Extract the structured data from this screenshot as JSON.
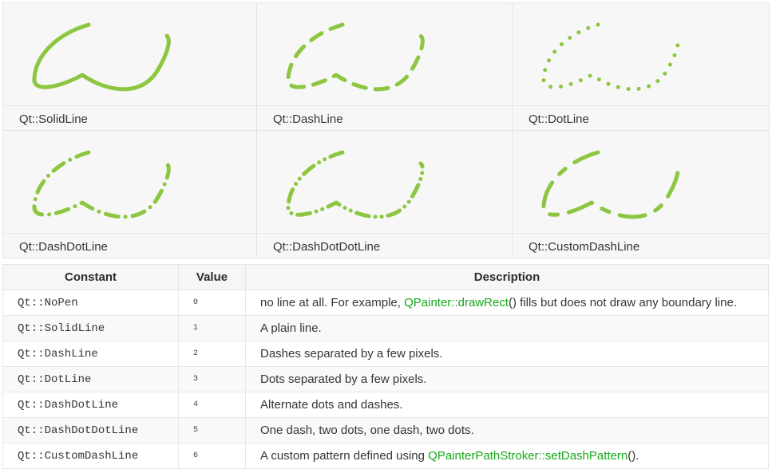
{
  "colors": {
    "stroke": "#8dc640",
    "link": "#17a81a",
    "text": "#363534"
  },
  "pens": [
    {
      "caption": "Qt::SolidLine",
      "dash": ""
    },
    {
      "caption": "Qt::DashLine",
      "dash": "16 12"
    },
    {
      "caption": "Qt::DotLine",
      "dash": "0 13"
    },
    {
      "caption": "Qt::DashDotLine",
      "dash": "16 9 0 9"
    },
    {
      "caption": "Qt::DashDotDotLine",
      "dash": "16 8 0 8 0 8"
    },
    {
      "caption": "Qt::CustomDashLine",
      "dash": "32 14 10 14"
    }
  ],
  "table": {
    "headers": {
      "constant": "Constant",
      "value": "Value",
      "description": "Description"
    },
    "rows": [
      {
        "constant": "Qt::NoPen",
        "value": "0",
        "desc_before": "no line at all. For example, ",
        "link": "QPainter::drawRect",
        "desc_after": "() fills but does not draw any boundary line."
      },
      {
        "constant": "Qt::SolidLine",
        "value": "1",
        "desc_before": "A plain line.",
        "link": "",
        "desc_after": ""
      },
      {
        "constant": "Qt::DashLine",
        "value": "2",
        "desc_before": "Dashes separated by a few pixels.",
        "link": "",
        "desc_after": ""
      },
      {
        "constant": "Qt::DotLine",
        "value": "3",
        "desc_before": "Dots separated by a few pixels.",
        "link": "",
        "desc_after": ""
      },
      {
        "constant": "Qt::DashDotLine",
        "value": "4",
        "desc_before": "Alternate dots and dashes.",
        "link": "",
        "desc_after": ""
      },
      {
        "constant": "Qt::DashDotDotLine",
        "value": "5",
        "desc_before": "One dash, two dots, one dash, two dots.",
        "link": "",
        "desc_after": ""
      },
      {
        "constant": "Qt::CustomDashLine",
        "value": "6",
        "desc_before": "A custom pattern defined using ",
        "link": "QPainterPathStroker::setDashPattern",
        "desc_after": "()."
      }
    ]
  }
}
